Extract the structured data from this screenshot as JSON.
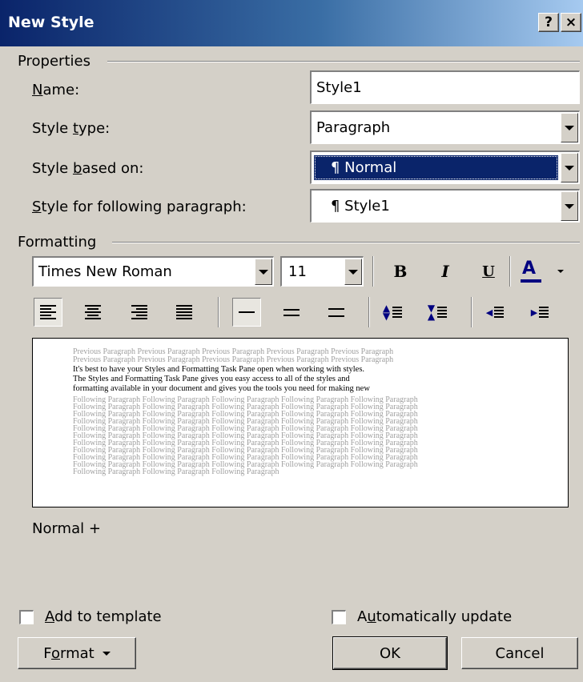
{
  "window": {
    "title": "New Style",
    "help_glyph": "?",
    "close_glyph": "×"
  },
  "properties": {
    "group_label": "Properties",
    "name_label": "Name:",
    "name_value": "Style1",
    "style_type_label": "Style type:",
    "style_type_value": "Paragraph",
    "based_on_label": "Style based on:",
    "based_on_value": "¶ Normal",
    "following_label": "Style for following paragraph:",
    "following_value": "¶ Style1"
  },
  "formatting": {
    "group_label": "Formatting",
    "font_name": "Times New Roman",
    "font_size": "11",
    "bold_glyph": "B",
    "italic_glyph": "I",
    "underline_glyph": "U",
    "font_color_glyph": "A",
    "font_color": "#000080"
  },
  "preview": {
    "previous_line_1": "Previous Paragraph Previous Paragraph Previous Paragraph Previous Paragraph Previous Paragraph",
    "previous_line_2": "Previous Paragraph Previous Paragraph Previous Paragraph Previous Paragraph Previous Paragraph",
    "sample_line_1": "It's best to have your Styles and Formatting Task Pane open when working with styles.",
    "sample_line_2": "The Styles and Formatting Task Pane gives you easy access to all of the styles and",
    "sample_line_3": "formatting available in your document and gives you the tools you need for making new",
    "following_line": "Following Paragraph Following Paragraph Following Paragraph Following Paragraph Following Paragraph",
    "following_last": "Following Paragraph Following Paragraph Following Paragraph"
  },
  "description": "Normal +",
  "options": {
    "add_to_template": "Add to template",
    "add_to_template_checked": false,
    "auto_update": "Automatically update",
    "auto_update_checked": false
  },
  "buttons": {
    "format": "Format",
    "ok": "OK",
    "cancel": "Cancel"
  }
}
